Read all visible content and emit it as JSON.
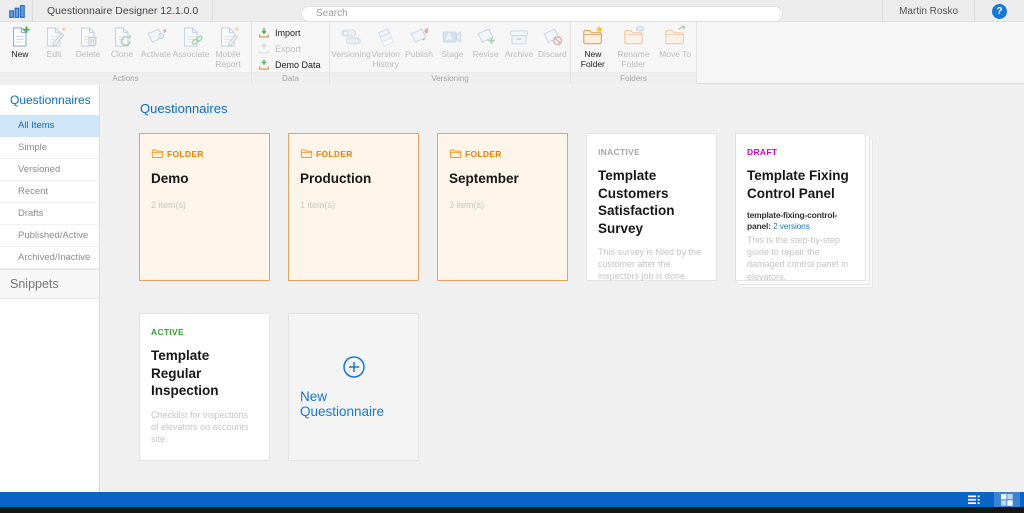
{
  "app": {
    "title": "Questionnaire Designer 12.1.0.0",
    "user": "Martin Rosko",
    "search_placeholder": "Search",
    "help": "?",
    "logo_icon": "bar-chart-logo-icon"
  },
  "ribbon": {
    "groups": [
      {
        "label": "Actions",
        "buttons": [
          {
            "label": "New",
            "enabled": true,
            "icon": "document-new-icon"
          },
          {
            "label": "Edit",
            "enabled": false,
            "icon": "document-edit-icon"
          },
          {
            "label": "Delete",
            "enabled": false,
            "icon": "document-delete-icon"
          },
          {
            "label": "Clone",
            "enabled": false,
            "icon": "document-clone-icon"
          },
          {
            "label": "Activate",
            "enabled": false,
            "icon": "document-activate-icon"
          },
          {
            "label": "Associate",
            "enabled": false,
            "icon": "document-associate-icon"
          },
          {
            "label": "Mobile Report",
            "enabled": false,
            "icon": "mobile-report-icon"
          }
        ]
      },
      {
        "label": "Data",
        "buttons": [
          {
            "label": "Import",
            "enabled": true,
            "icon": "import-icon"
          },
          {
            "label": "Export",
            "enabled": false,
            "icon": "export-icon"
          },
          {
            "label": "Demo Data",
            "enabled": true,
            "icon": "demo-data-icon"
          }
        ]
      },
      {
        "label": "Versioning",
        "buttons": [
          {
            "label": "Versioning",
            "enabled": false,
            "icon": "versioning-icon"
          },
          {
            "label": "Version History",
            "enabled": false,
            "icon": "version-history-icon"
          },
          {
            "label": "Publish",
            "enabled": false,
            "icon": "publish-icon"
          },
          {
            "label": "Stage",
            "enabled": false,
            "icon": "stage-icon"
          },
          {
            "label": "Revise",
            "enabled": false,
            "icon": "revise-icon"
          },
          {
            "label": "Archive",
            "enabled": false,
            "icon": "archive-icon"
          },
          {
            "label": "Discard",
            "enabled": false,
            "icon": "discard-icon"
          }
        ]
      },
      {
        "label": "Folders",
        "buttons": [
          {
            "label": "New Folder",
            "enabled": true,
            "icon": "new-folder-icon"
          },
          {
            "label": "Rename Folder",
            "enabled": false,
            "icon": "rename-folder-icon"
          },
          {
            "label": "Move To",
            "enabled": false,
            "icon": "move-to-folder-icon"
          }
        ]
      }
    ]
  },
  "sidebar": {
    "sections": [
      {
        "label": "Questionnaires",
        "items": [
          {
            "label": "All Items",
            "selected": true
          },
          {
            "label": "Simple",
            "selected": false
          },
          {
            "label": "Versioned",
            "selected": false
          },
          {
            "label": "Recent",
            "selected": false
          },
          {
            "label": "Drafts",
            "selected": false
          },
          {
            "label": "Published/Active",
            "selected": false
          },
          {
            "label": "Archived/Inactive",
            "selected": false
          }
        ]
      },
      {
        "label": "Snippets",
        "items": []
      }
    ]
  },
  "main": {
    "title": "Questionnaires",
    "cards": [
      {
        "type": "folder",
        "badge": "FOLDER",
        "title": "Demo",
        "meta": "2 item(s)"
      },
      {
        "type": "folder",
        "badge": "FOLDER",
        "title": "Production",
        "meta": "1 item(s)"
      },
      {
        "type": "folder",
        "badge": "FOLDER",
        "title": "September",
        "meta": "3 item(s)"
      },
      {
        "type": "template",
        "status": "INACTIVE",
        "title": "Template Customers Satisfaction Survey",
        "description": "This survey is filled by the customer after the inspectors job is done."
      },
      {
        "type": "template",
        "status": "DRAFT",
        "title": "Template Fixing Control Panel",
        "slug": "template-fixing-control-panel:",
        "versions_link": "2 versions",
        "description": "This is the step-by-step guide to repair the damaged control panel in elevators.",
        "stacked": true
      },
      {
        "type": "template",
        "status": "ACTIVE",
        "title": "Template Regular Inspection",
        "description": "Checklist for inspections of elevators on accounts site."
      },
      {
        "type": "new",
        "label": "New Questionnaire",
        "icon": "plus-circle-icon"
      }
    ]
  },
  "statusbar": {
    "icons": [
      {
        "name": "list-view-icon",
        "selected": false
      },
      {
        "name": "grid-view-icon",
        "selected": true
      }
    ]
  },
  "colors": {
    "accent_blue": "#0f6cbd",
    "statusbar_blue": "#0a64c8",
    "folder_border": "#e0a468",
    "folder_badge_orange": "#e8820c",
    "status_inactive": "#a7a7a7",
    "status_draft": "#d400c0",
    "status_active": "#2ea52c",
    "link_blue": "#1e7ac9"
  }
}
